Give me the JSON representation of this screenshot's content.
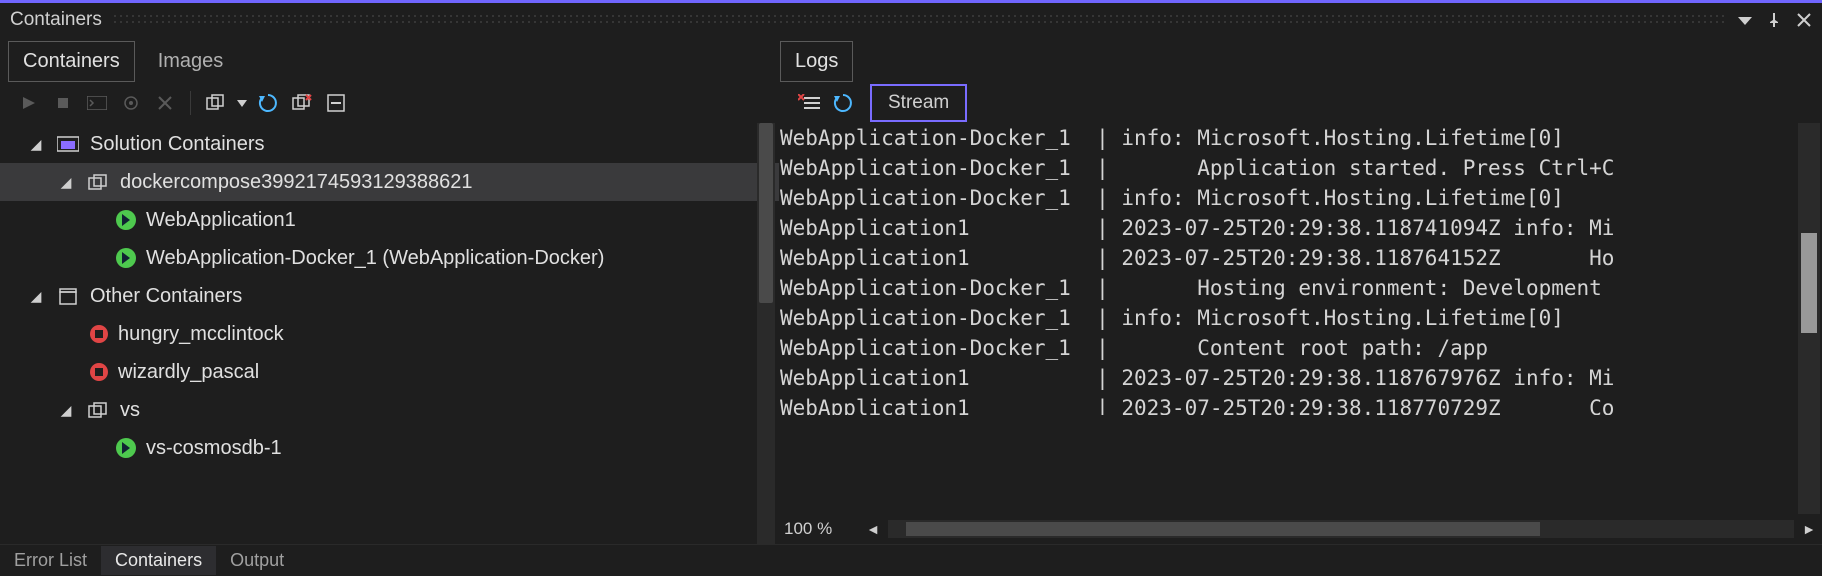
{
  "title": "Containers",
  "left_tabs": [
    {
      "label": "Containers",
      "active": true
    },
    {
      "label": "Images",
      "active": false
    }
  ],
  "right_tabs": [
    {
      "label": "Logs",
      "active": true
    }
  ],
  "stream_button": "Stream",
  "zoom_label": "100 %",
  "tree": {
    "solution_label": "Solution Containers",
    "compose_label": "dockercompose3992174593129388621",
    "compose_children": [
      {
        "label": "WebApplication1"
      },
      {
        "label": "WebApplication-Docker_1 (WebApplication-Docker)"
      }
    ],
    "other_label": "Other Containers",
    "other_children": [
      {
        "label": "hungry_mcclintock"
      },
      {
        "label": "wizardly_pascal"
      }
    ],
    "vs_label": "vs",
    "vs_children": [
      {
        "label": "vs-cosmosdb-1"
      }
    ]
  },
  "log_lines": [
    "WebApplication-Docker_1  | info: Microsoft.Hosting.Lifetime[0]",
    "WebApplication-Docker_1  |       Application started. Press Ctrl+C",
    "WebApplication-Docker_1  | info: Microsoft.Hosting.Lifetime[0]",
    "WebApplication1          | 2023-07-25T20:29:38.118741094Z info: Mi",
    "WebApplication1          | 2023-07-25T20:29:38.118764152Z       Ho",
    "WebApplication-Docker_1  |       Hosting environment: Development",
    "WebApplication-Docker_1  | info: Microsoft.Hosting.Lifetime[0]",
    "WebApplication-Docker_1  |       Content root path: /app",
    "WebApplication1          | 2023-07-25T20:29:38.118767976Z info: Mi",
    "WebApplication1          | 2023-07-25T20:29:38.118770729Z       Co"
  ],
  "bottom_tabs": [
    {
      "label": "Error List",
      "active": false
    },
    {
      "label": "Containers",
      "active": true
    },
    {
      "label": "Output",
      "active": false
    }
  ]
}
